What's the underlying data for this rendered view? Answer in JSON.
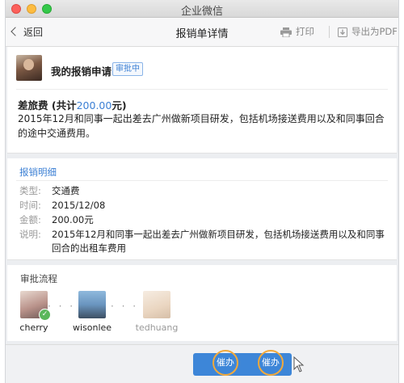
{
  "window": {
    "title": "企业微信"
  },
  "toolbar": {
    "back_label": "返回",
    "page_title": "报销单详情",
    "print_label": "打印",
    "export_pdf_label": "导出为PDF"
  },
  "applicant": {
    "title": "我的报销申请",
    "status": "审批中"
  },
  "expense": {
    "type_label": "差旅费",
    "total_prefix": "(共计",
    "total_amount": "200.00",
    "total_suffix": "元)",
    "description": "2015年12月和同事一起出差去广州做新项目研发，包括机场接送费用以及和同事回合的途中交通费用。"
  },
  "details": {
    "section_title": "报销明细",
    "rows": [
      {
        "key": "类型:",
        "value": "交通费"
      },
      {
        "key": "时间:",
        "value": "2015/12/08"
      },
      {
        "key": "金额:",
        "value": "200.00元"
      },
      {
        "key": "说明:",
        "value": "2015年12月和同事一起出差去广州做新项目研发，包括机场接送费用以及和同事回合的出租车费用"
      }
    ]
  },
  "approval": {
    "section_title": "审批流程",
    "people": [
      {
        "name": "cherry",
        "done": true
      },
      {
        "name": "wisonlee",
        "done": false
      },
      {
        "name": "tedhuang",
        "done": false
      }
    ],
    "connector": "· · ·"
  },
  "footer": {
    "urge_label": "催办",
    "urge_label_2": "催办"
  },
  "colors": {
    "accent": "#3b7fd4",
    "button": "#3d86d8",
    "highlight_ring": "#f2a93b",
    "approved": "#5bb75b"
  }
}
